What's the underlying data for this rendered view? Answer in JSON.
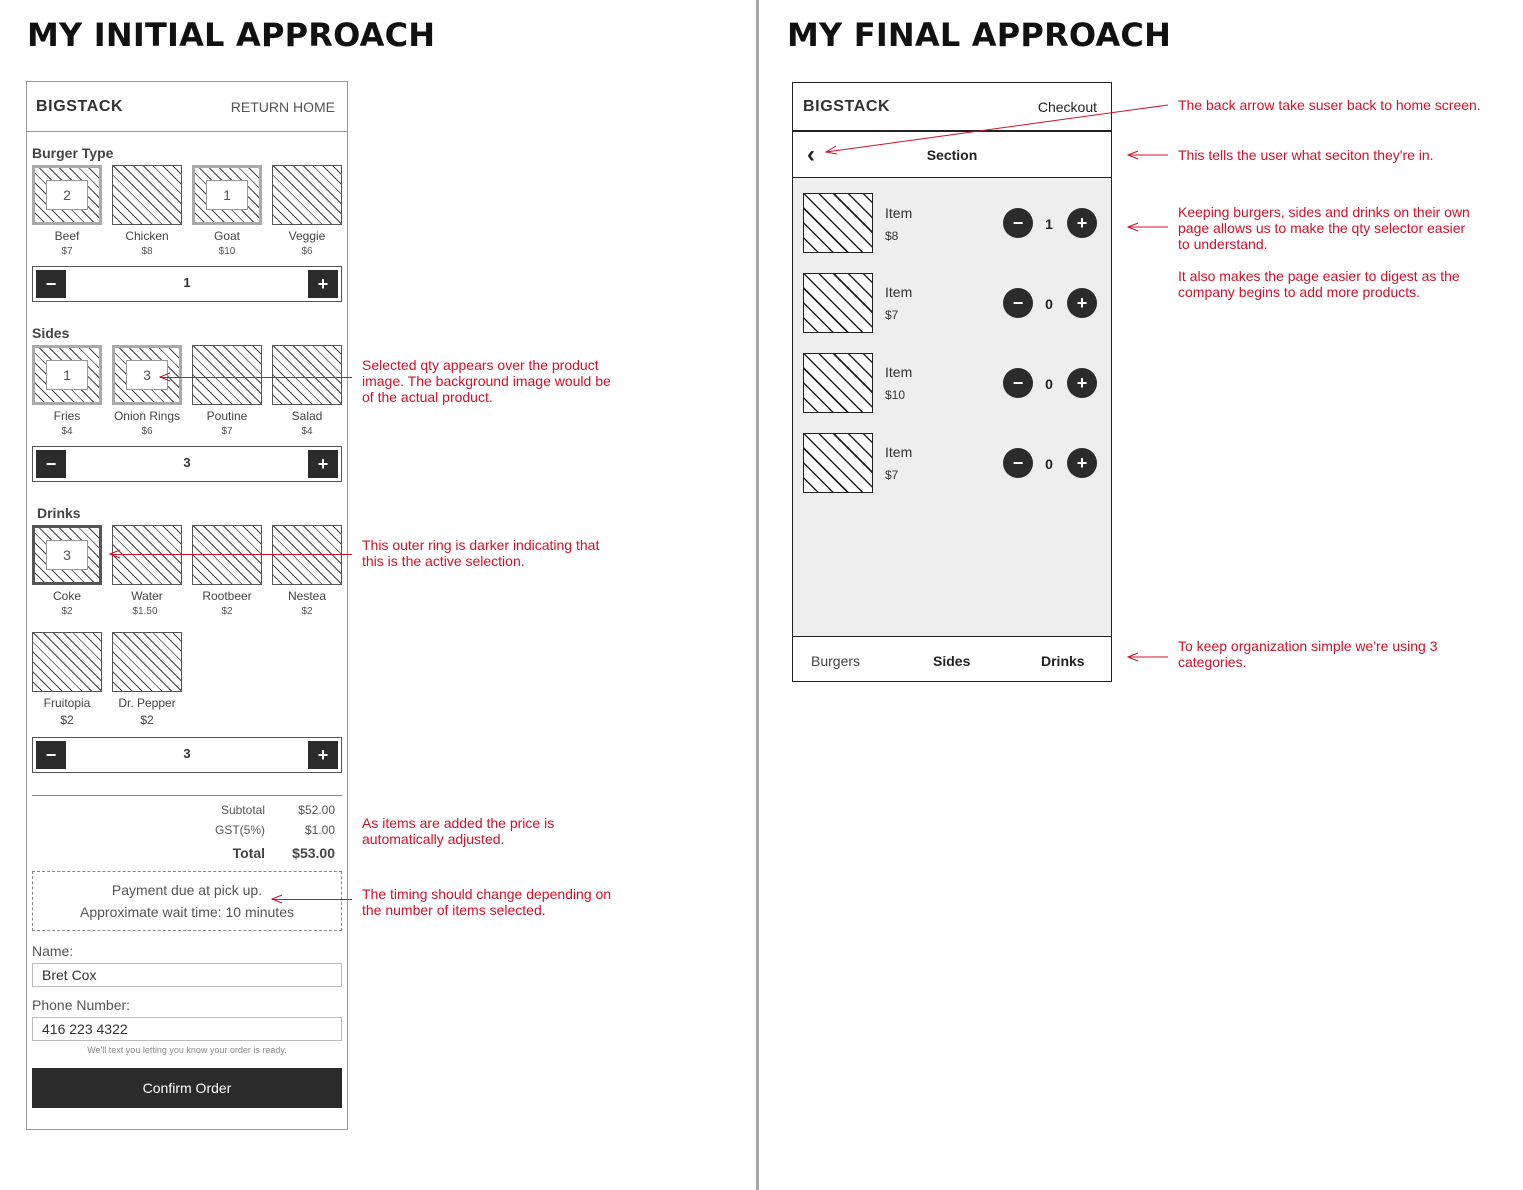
{
  "headings": {
    "left": "MY INITIAL APPROACH",
    "right": "MY FINAL APPROACH"
  },
  "initial": {
    "brand": "BIGSTACK",
    "return_home": "RETURN HOME",
    "burger": {
      "title": "Burger Type",
      "items": [
        {
          "name": "Beef",
          "price": "$7",
          "qty": "2"
        },
        {
          "name": "Chicken",
          "price": "$8",
          "qty": ""
        },
        {
          "name": "Goat",
          "price": "$10",
          "qty": "1"
        },
        {
          "name": "Veggie",
          "price": "$6",
          "qty": ""
        }
      ],
      "stepper": {
        "minus": "−",
        "value": "1",
        "plus": "+"
      }
    },
    "sides": {
      "title": "Sides",
      "items": [
        {
          "name": "Fries",
          "price": "$4",
          "qty": "1"
        },
        {
          "name": "Onion Rings",
          "price": "$6",
          "qty": "3"
        },
        {
          "name": "Poutine",
          "price": "$7",
          "qty": ""
        },
        {
          "name": "Salad",
          "price": "$4",
          "qty": ""
        }
      ],
      "stepper": {
        "minus": "−",
        "value": "3",
        "plus": "+"
      }
    },
    "drinks": {
      "title": "Drinks",
      "items": [
        {
          "name": "Coke",
          "price": "$2",
          "qty": "3"
        },
        {
          "name": "Water",
          "price": "$1.50",
          "qty": ""
        },
        {
          "name": "Rootbeer",
          "price": "$2",
          "qty": ""
        },
        {
          "name": "Nestea",
          "price": "$2",
          "qty": ""
        },
        {
          "name": "Fruitopia",
          "price": "$2",
          "qty": ""
        },
        {
          "name": "Dr. Pepper",
          "price": "$2",
          "qty": ""
        }
      ],
      "stepper": {
        "minus": "−",
        "value": "3",
        "plus": "+"
      }
    },
    "totals": {
      "subtotal_label": "Subtotal",
      "subtotal": "$52.00",
      "gst_label": "GST(5%)",
      "gst": "$1.00",
      "total_label": "Total",
      "total": "$53.00"
    },
    "payment": {
      "line1": "Payment due at pick up.",
      "line2": "Approximate wait time: 10 minutes"
    },
    "name_label": "Name:",
    "name_value": "Bret Cox",
    "phone_label": "Phone Number:",
    "phone_value": "416 223 4322",
    "helper": "We'll text you letting you know your order is ready.",
    "confirm": "Confirm Order"
  },
  "final": {
    "brand": "BIGSTACK",
    "checkout": "Checkout",
    "back": "‹",
    "section": "Section",
    "items": [
      {
        "name": "Item",
        "price": "$8",
        "qty": "1"
      },
      {
        "name": "Item",
        "price": "$7",
        "qty": "0"
      },
      {
        "name": "Item",
        "price": "$10",
        "qty": "0"
      },
      {
        "name": "Item",
        "price": "$7",
        "qty": "0"
      }
    ],
    "minus": "−",
    "plus": "+",
    "tabs": [
      "Burgers",
      "Sides",
      "Drinks"
    ]
  },
  "notes": {
    "selected_qty": "Selected qty appears over the product image. The background image would be of the actual product.",
    "outer_ring": "This outer ring is darker indicating that this is the active selection.",
    "price_adjust": "As items are added the price is automatically adjusted.",
    "timing": "The timing should change depending on the number of items selected.",
    "back_arrow": "The back arrow take suser back to home screen.",
    "section": "This tells the user what seciton they're in.",
    "separate_pages": "Keeping burgers, sides and drinks on their own page allows us to make the qty selector easier to understand.",
    "digest": "It also makes the page easier to digest as the company begins to add more products.",
    "categories": "To keep organization simple we're using 3 categories."
  },
  "colors": {
    "annotation": "#d0112b",
    "dark_button": "#2b2b2b",
    "panel_bg": "#eeeeee"
  }
}
